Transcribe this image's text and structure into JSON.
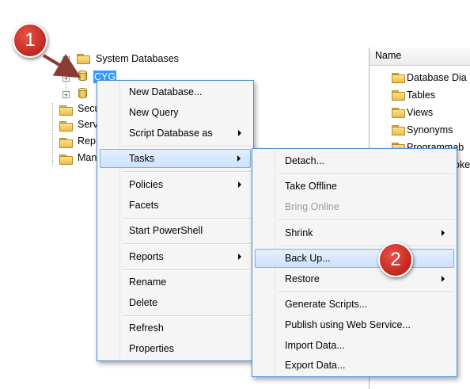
{
  "tree": {
    "system_databases": "System Databases",
    "selected_db": "CYG",
    "items": [
      "Secu",
      "Serv",
      "Rep",
      "Man"
    ]
  },
  "right_pane": {
    "header": "Name",
    "items": [
      "Database Dia",
      "Tables",
      "Views",
      "Synonyms",
      "Programmab",
      "oke"
    ]
  },
  "context_menu": {
    "items": [
      "New Database...",
      "New Query",
      "Script Database as",
      "Tasks",
      "Policies",
      "Facets",
      "Start PowerShell",
      "Reports",
      "Rename",
      "Delete",
      "Refresh",
      "Properties"
    ]
  },
  "tasks_submenu": {
    "items": [
      "Detach...",
      "Take Offline",
      "Bring Online",
      "Shrink",
      "Back Up...",
      "Restore",
      "Generate Scripts...",
      "Publish using Web Service...",
      "Import Data...",
      "Export Data..."
    ]
  },
  "callouts": {
    "first": "1",
    "second": "2"
  },
  "colors": {
    "menu_border": "#4f8ed6",
    "highlight": "#cce2fb",
    "callout": "#d0342c",
    "selection": "#3399ff"
  }
}
